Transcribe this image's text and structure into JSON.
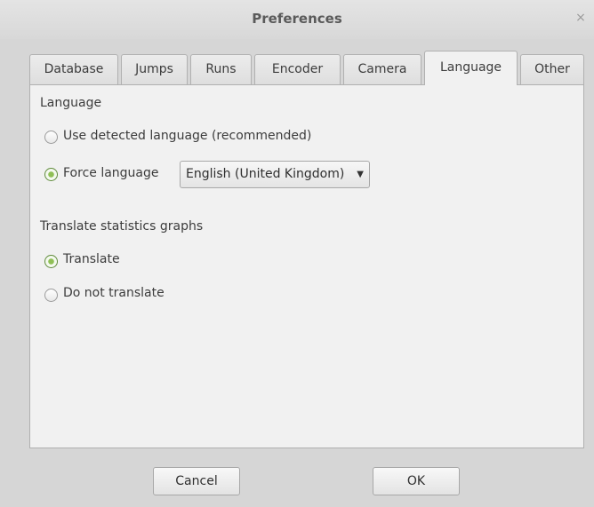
{
  "window": {
    "title": "Preferences",
    "close_glyph": "×"
  },
  "tabs": [
    {
      "label": "Database",
      "active": false
    },
    {
      "label": "Jumps",
      "active": false
    },
    {
      "label": "Runs",
      "active": false
    },
    {
      "label": "Encoder",
      "active": false
    },
    {
      "label": "Camera",
      "active": false
    },
    {
      "label": "Language",
      "active": true
    },
    {
      "label": "Other",
      "active": false
    }
  ],
  "language_section": {
    "heading": "Language",
    "options": [
      {
        "label": "Use detected language (recommended)",
        "checked": false
      },
      {
        "label": "Force language",
        "checked": true
      }
    ],
    "language_select": {
      "selected": "English (United Kingdom)",
      "arrow": "▼"
    }
  },
  "graphs_section": {
    "heading": "Translate statistics graphs",
    "options": [
      {
        "label": "Translate",
        "checked": true
      },
      {
        "label": "Do not translate",
        "checked": false
      }
    ]
  },
  "buttons": {
    "cancel": "Cancel",
    "ok": "OK"
  },
  "colors": {
    "radio_checked": "#8fbf55",
    "dialog_bg": "#d6d6d6",
    "panel_bg": "#f1f1f1"
  }
}
